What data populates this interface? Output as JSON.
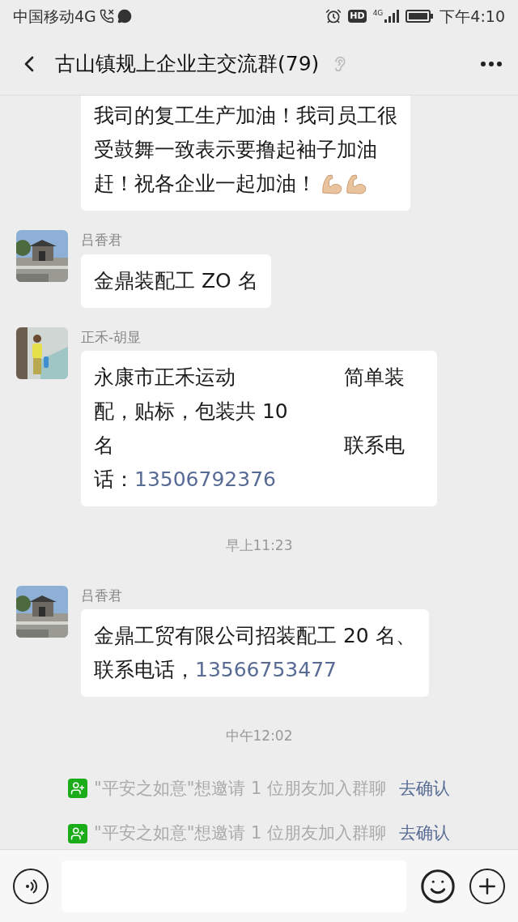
{
  "status_bar": {
    "carrier": "中国移动4G",
    "network_badge": "HD",
    "network_type": "4G",
    "time": "下午4:10"
  },
  "header": {
    "title": "古山镇规上企业主交流群(79)"
  },
  "chat": [
    {
      "kind": "message",
      "cut_top": true,
      "lines": [
        {
          "text": "我司的复工生产加油！我司员工很"
        },
        {
          "text": "受鼓舞一致表示要撸起袖子加油"
        },
        {
          "text": "赶！祝各企业一起加油！",
          "emoji": true
        }
      ]
    },
    {
      "kind": "message",
      "sender": "吕香君",
      "avatar": {
        "kind": "picture"
      },
      "lines": [
        {
          "text": "金鼎装配工 ZO 名"
        }
      ]
    },
    {
      "kind": "message",
      "sender": "正禾-胡显",
      "avatar": {
        "kind": "picture"
      },
      "lines": [
        {
          "text": "永康市正禾运动",
          "right": "简单装"
        },
        {
          "text": "配，贴标，包装共 10"
        },
        {
          "text": "名",
          "right": "联系电"
        },
        {
          "text": "话：",
          "link": "13506792376"
        }
      ]
    },
    {
      "kind": "time",
      "text": "早上11:23"
    },
    {
      "kind": "message",
      "sender": "吕香君",
      "avatar": {
        "kind": "picture"
      },
      "lines": [
        {
          "text": "金鼎工贸有限公司招装配工 20 名、"
        },
        {
          "text": "联系电话，",
          "link": "13566753477"
        }
      ]
    },
    {
      "kind": "time",
      "text": "中午12:02"
    },
    {
      "kind": "notice",
      "text": "\"平安之如意\"想邀请 1 位朋友加入群聊",
      "link": "去确认"
    },
    {
      "kind": "notice",
      "text": "\"平安之如意\"想邀请 1 位朋友加入群聊",
      "link": "去确认"
    }
  ]
}
